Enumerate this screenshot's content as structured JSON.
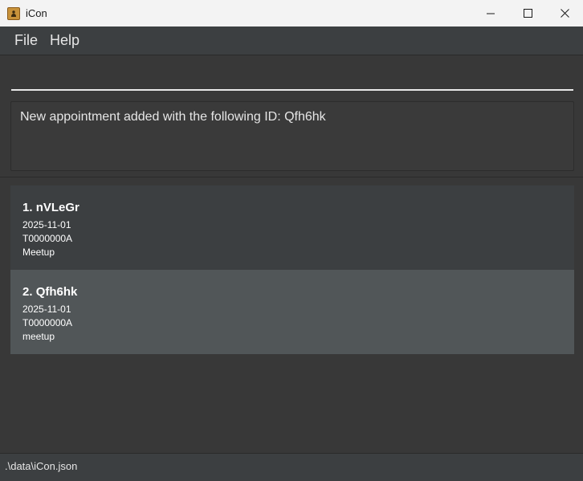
{
  "window": {
    "title": "iCon"
  },
  "menu": {
    "file": "File",
    "help": "Help"
  },
  "command": {
    "value": ""
  },
  "result": {
    "message": "New appointment added with the following ID: Qfh6hk"
  },
  "appointments": [
    {
      "index": "1.",
      "id": "nVLeGr",
      "date": "2025-11-01",
      "nric": "T0000000A",
      "description": "Meetup"
    },
    {
      "index": "2.",
      "id": "Qfh6hk",
      "date": "2025-11-01",
      "nric": "T0000000A",
      "description": "meetup"
    }
  ],
  "status": {
    "path": ".\\data\\iCon.json"
  },
  "colors": {
    "background": "#3c3f41",
    "selected_card": "#515658",
    "titlebar": "#f3f3f3"
  }
}
